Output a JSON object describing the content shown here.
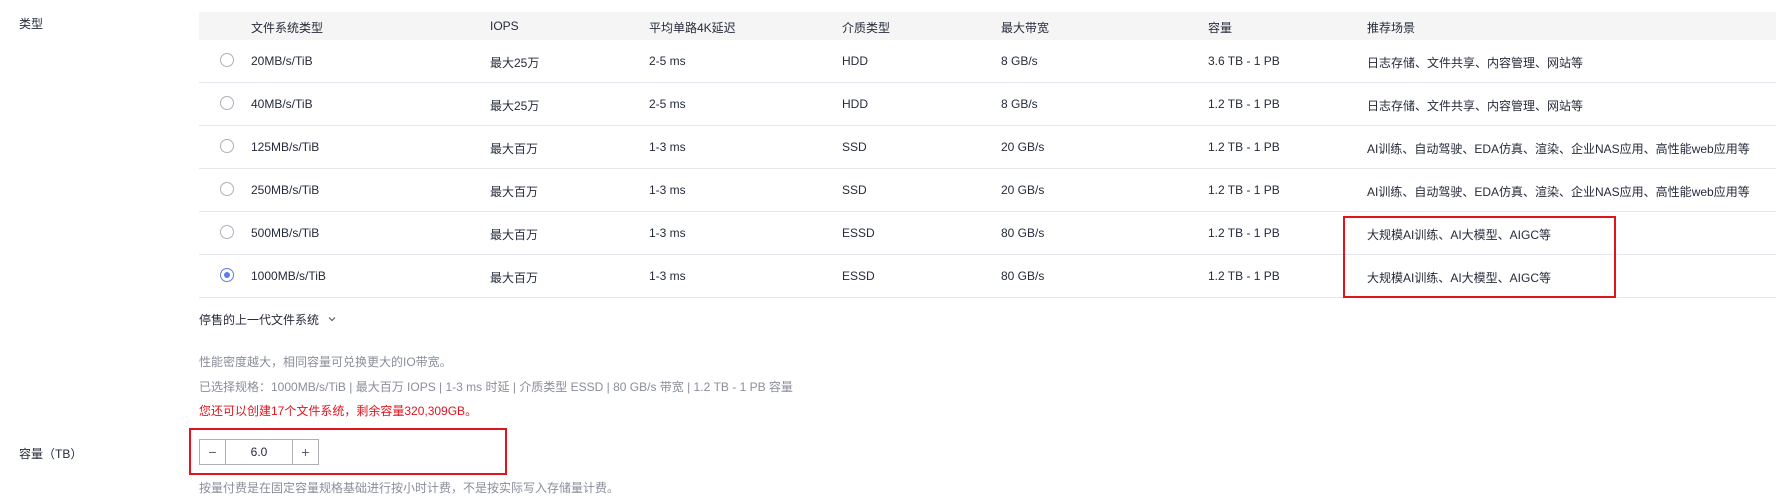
{
  "type_label": "类型",
  "table": {
    "headers": [
      "文件系统类型",
      "IOPS",
      "平均单路4K延迟",
      "介质类型",
      "最大带宽",
      "容量",
      "推荐场景"
    ],
    "rows": [
      {
        "name": "20MB/s/TiB",
        "iops": "最大25万",
        "latency": "2-5 ms",
        "media": "HDD",
        "bandwidth": "8 GB/s",
        "capacity": "3.6 TB - 1 PB",
        "scenario": "日志存储、文件共享、内容管理、网站等",
        "selected": false
      },
      {
        "name": "40MB/s/TiB",
        "iops": "最大25万",
        "latency": "2-5 ms",
        "media": "HDD",
        "bandwidth": "8 GB/s",
        "capacity": "1.2 TB - 1 PB",
        "scenario": "日志存储、文件共享、内容管理、网站等",
        "selected": false
      },
      {
        "name": "125MB/s/TiB",
        "iops": "最大百万",
        "latency": "1-3 ms",
        "media": "SSD",
        "bandwidth": "20 GB/s",
        "capacity": "1.2 TB - 1 PB",
        "scenario": "AI训练、自动驾驶、EDA仿真、渲染、企业NAS应用、高性能web应用等",
        "selected": false
      },
      {
        "name": "250MB/s/TiB",
        "iops": "最大百万",
        "latency": "1-3 ms",
        "media": "SSD",
        "bandwidth": "20 GB/s",
        "capacity": "1.2 TB - 1 PB",
        "scenario": "AI训练、自动驾驶、EDA仿真、渲染、企业NAS应用、高性能web应用等",
        "selected": false
      },
      {
        "name": "500MB/s/TiB",
        "iops": "最大百万",
        "latency": "1-3 ms",
        "media": "ESSD",
        "bandwidth": "80 GB/s",
        "capacity": "1.2 TB - 1 PB",
        "scenario": "大规模AI训练、AI大模型、AIGC等",
        "selected": false
      },
      {
        "name": "1000MB/s/TiB",
        "iops": "最大百万",
        "latency": "1-3 ms",
        "media": "ESSD",
        "bandwidth": "80 GB/s",
        "capacity": "1.2 TB - 1 PB",
        "scenario": "大规模AI训练、AI大模型、AIGC等",
        "selected": true
      }
    ]
  },
  "legacy_toggle": "停售的上一代文件系统",
  "note_density": "性能密度越大，相同容量可兑换更大的IO带宽。",
  "selected_spec": "已选择规格：1000MB/s/TiB | 最大百万 IOPS | 1-3 ms 时延 | 介质类型 ESSD | 80 GB/s 带宽 | 1.2 TB - 1 PB 容量",
  "quota_warning": "您还可以创建17个文件系统，剩余容量320,309GB。",
  "capacity": {
    "label": "容量（TB）",
    "value": "6.0",
    "minus": "−",
    "plus": "+"
  },
  "billing_note": "按量付费是在固定容量规格基础进行按小时计费，不是按实际写入存储量计费。",
  "colors": {
    "accent": "#5e7ce0",
    "highlight_box": "#e1141e",
    "warning_text": "#e1141e"
  }
}
